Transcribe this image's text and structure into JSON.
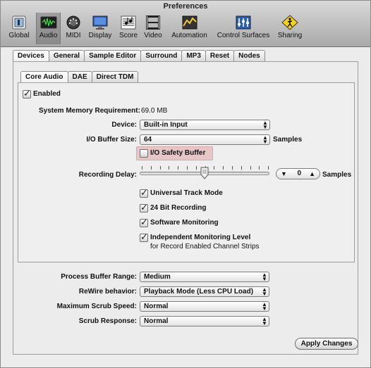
{
  "window": {
    "title": "Preferences"
  },
  "toolbar": {
    "items": [
      {
        "label": "Global",
        "icon": "global-icon"
      },
      {
        "label": "Audio",
        "icon": "audio-icon",
        "selected": true
      },
      {
        "label": "MIDI",
        "icon": "midi-icon"
      },
      {
        "label": "Display",
        "icon": "display-icon"
      },
      {
        "label": "Score",
        "icon": "score-icon"
      },
      {
        "label": "Video",
        "icon": "video-icon"
      },
      {
        "label": "Automation",
        "icon": "automation-icon"
      },
      {
        "label": "Control Surfaces",
        "icon": "control-surfaces-icon"
      },
      {
        "label": "Sharing",
        "icon": "sharing-icon"
      }
    ]
  },
  "tabs": {
    "main": [
      "Devices",
      "General",
      "Sample Editor",
      "Surround",
      "MP3",
      "Reset",
      "Nodes"
    ],
    "driver": [
      "Core Audio",
      "DAE",
      "Direct TDM"
    ]
  },
  "core_audio": {
    "enabled_label": "Enabled",
    "enabled": true,
    "memory_label": "System Memory Requirement:",
    "memory_value": "69.0 MB",
    "device_label": "Device:",
    "device_value": "Built-in Input",
    "buffer_label": "I/O Buffer Size:",
    "buffer_value": "64",
    "buffer_unit": "Samples",
    "safety_label": "I/O Safety Buffer",
    "safety_checked": false,
    "delay_label": "Recording Delay:",
    "delay_value": "0",
    "delay_unit": "Samples",
    "options": [
      {
        "label": "Universal Track Mode",
        "checked": true
      },
      {
        "label": "24 Bit Recording",
        "checked": true
      },
      {
        "label": "Software Monitoring",
        "checked": true
      },
      {
        "label": "Independent Monitoring Level",
        "sublabel": "for Record Enabled Channel Strips",
        "checked": true
      }
    ]
  },
  "lower": {
    "process_buffer_label": "Process Buffer Range:",
    "process_buffer_value": "Medium",
    "rewire_label": "ReWire behavior:",
    "rewire_value": "Playback Mode (Less CPU Load)",
    "scrub_speed_label": "Maximum Scrub Speed:",
    "scrub_speed_value": "Normal",
    "scrub_response_label": "Scrub Response:",
    "scrub_response_value": "Normal"
  },
  "buttons": {
    "apply": "Apply Changes"
  }
}
